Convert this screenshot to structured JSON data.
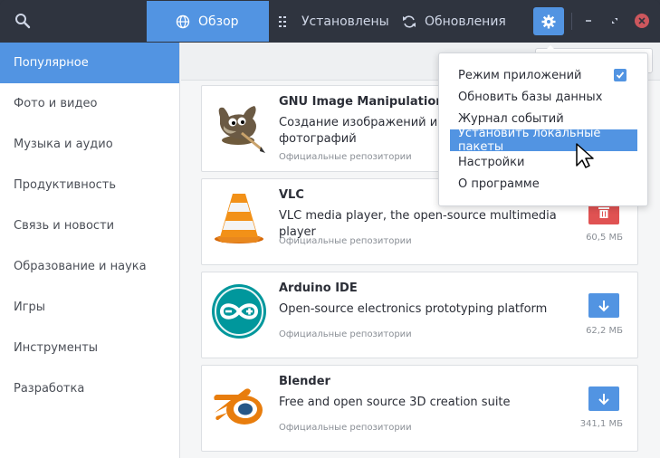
{
  "header": {
    "tabs": [
      {
        "label": "Обзор",
        "icon": "globe-icon",
        "active": true
      },
      {
        "label": "Установлены",
        "icon": "list-icon",
        "active": false
      },
      {
        "label": "Обновления",
        "icon": "refresh-icon",
        "active": false
      }
    ]
  },
  "sidebar": {
    "items": [
      {
        "label": "Популярное",
        "active": true
      },
      {
        "label": "Фото и видео"
      },
      {
        "label": "Музыка и аудио"
      },
      {
        "label": "Продуктивность"
      },
      {
        "label": "Связь и новости"
      },
      {
        "label": "Образование и наука"
      },
      {
        "label": "Игры"
      },
      {
        "label": "Инструменты"
      },
      {
        "label": "Разработка"
      }
    ]
  },
  "apps": [
    {
      "name": "GNU Image Manipulation Program",
      "description": "Создание изображений и редактирование фотографий",
      "repo": "Официальные репозитории",
      "icon": "gimp-icon"
    },
    {
      "name": "VLC",
      "description": "VLC media player, the open-source multimedia player",
      "repo": "Официальные репозитории",
      "size": "60,5 МБ",
      "action": "remove",
      "icon": "vlc-icon"
    },
    {
      "name": "Arduino IDE",
      "description": "Open-source electronics prototyping platform",
      "repo": "Официальные репозитории",
      "size": "62,2 МБ",
      "action": "install",
      "icon": "arduino-icon"
    },
    {
      "name": "Blender",
      "description": "Free and open source 3D creation suite",
      "repo": "Официальные репозитории",
      "size": "341,1 МБ",
      "action": "install",
      "icon": "blender-icon"
    }
  ],
  "menu": {
    "items": [
      {
        "label": "Режим приложений",
        "checked": true
      },
      {
        "label": "Обновить базы данных"
      },
      {
        "label": "Журнал событий"
      },
      {
        "label": "Установить локальные пакеты",
        "highlighted": true
      },
      {
        "label": "Настройки"
      },
      {
        "label": "О программе"
      }
    ]
  },
  "colors": {
    "accent": "#5294e2",
    "remove": "#e05252",
    "header_bg": "#2f343f",
    "close": "#cc575d"
  }
}
